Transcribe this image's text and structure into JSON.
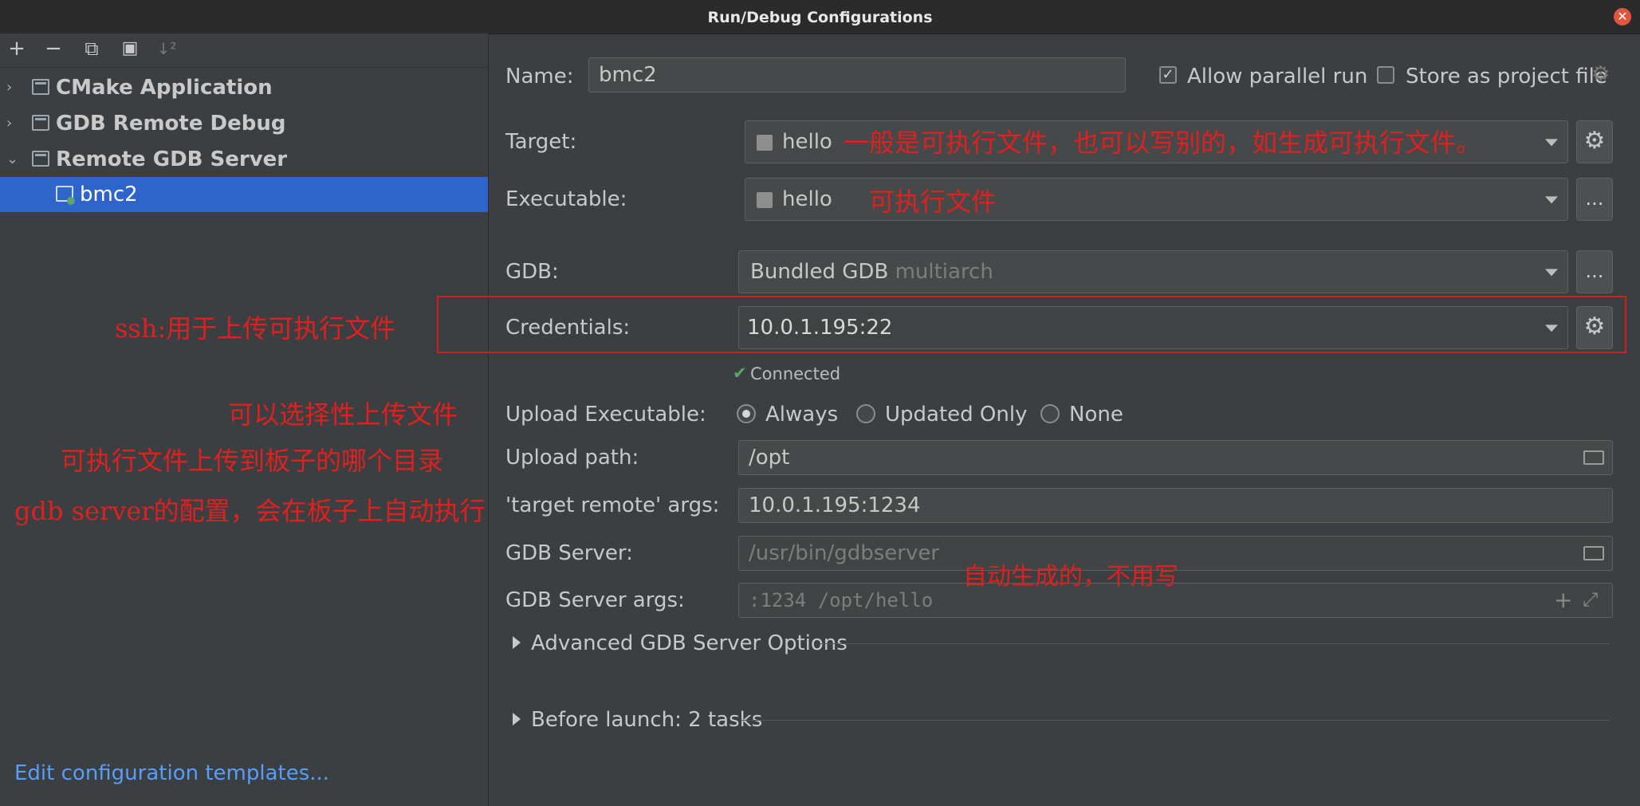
{
  "window": {
    "title": "Run/Debug Configurations",
    "close_icon": "✕"
  },
  "toolbar": {
    "add_icon": "+",
    "remove_icon": "−",
    "copy_icon": "⧉",
    "folder_icon": "▣",
    "sort_icon": "↓²"
  },
  "tree": {
    "items": [
      {
        "label": "CMake Application",
        "arrow": "›"
      },
      {
        "label": "GDB Remote Debug",
        "arrow": "›"
      },
      {
        "label": "Remote GDB Server",
        "arrow": "⌄"
      }
    ],
    "selected_item": {
      "label": "bmc2"
    }
  },
  "edit_templates_link": "Edit configuration templates...",
  "form": {
    "name_label": "Name:",
    "name_value": "bmc2",
    "allow_parallel_label": "Allow parallel run",
    "allow_parallel_checked": "✓",
    "store_project_label": "Store as project file",
    "target_label": "Target:",
    "target_value": "hello",
    "executable_label": "Executable:",
    "executable_value": "hello",
    "executable_button": "...",
    "gdb_label": "GDB:",
    "gdb_value": "Bundled GDB",
    "gdb_value_hint": "multiarch",
    "gdb_button": "...",
    "credentials_label": "Credentials:",
    "credentials_value": "10.0.1.195:22",
    "connected_icon": "✔",
    "connected_text": "Connected",
    "upload_label": "Upload Executable:",
    "upload_options": [
      "Always",
      "Updated Only",
      "None"
    ],
    "upload_path_label": "Upload path:",
    "upload_path_value": "/opt",
    "target_remote_label": "'target remote' args:",
    "target_remote_value": "10.0.1.195:1234",
    "gdb_server_label": "GDB Server:",
    "gdb_server_value": "/usr/bin/gdbserver",
    "gdb_server_args_label": "GDB Server args:",
    "gdb_server_args_value": ":1234 /opt/hello",
    "plus_icon": "+",
    "expand_icon": "⤢",
    "advanced_label": "Advanced GDB Server Options",
    "before_launch_label": "Before launch: 2 tasks"
  },
  "annotations": {
    "target_note": "一般是可执行文件，也可以写别的，如生成可执行文件。",
    "executable_note": "可执行文件",
    "ssh_note": "ssh:用于上传可执行文件",
    "upload_note": "可以选择性上传文件",
    "path_note": "可执行文件上传到板子的哪个目录",
    "gdbserver_note": "gdb server的配置，会在板子上自动执行",
    "autogen_note": "自动生成的，不用写"
  },
  "colors": {
    "background": "#3c3f41",
    "selection": "#2f65ca",
    "link": "#589df6",
    "annotation": "#e0201e",
    "connected": "#59a869"
  }
}
